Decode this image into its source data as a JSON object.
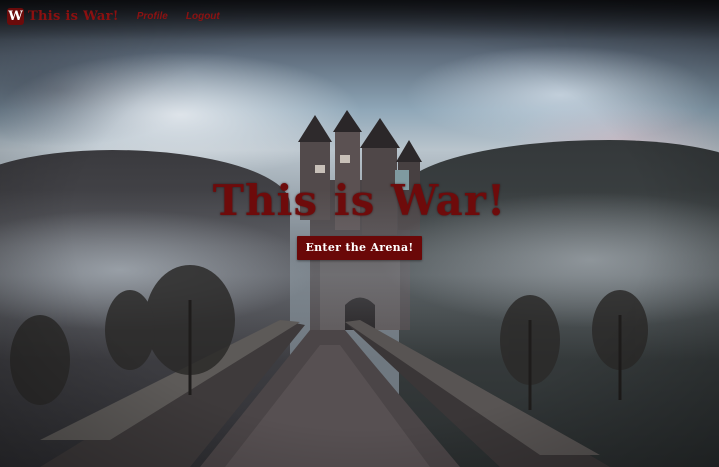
{
  "header": {
    "logo_letter": "W",
    "brand_name": "This is War!",
    "nav": [
      {
        "label": "Profile"
      },
      {
        "label": "Logout"
      }
    ]
  },
  "hero": {
    "title": "This is War!",
    "cta_label": "Enter the Arena!"
  },
  "background": {
    "description_icon": "castle-landscape-image"
  },
  "colors": {
    "brand": "#8b1010",
    "button_bg": "#6a0808",
    "title": "#6e0b0b"
  }
}
